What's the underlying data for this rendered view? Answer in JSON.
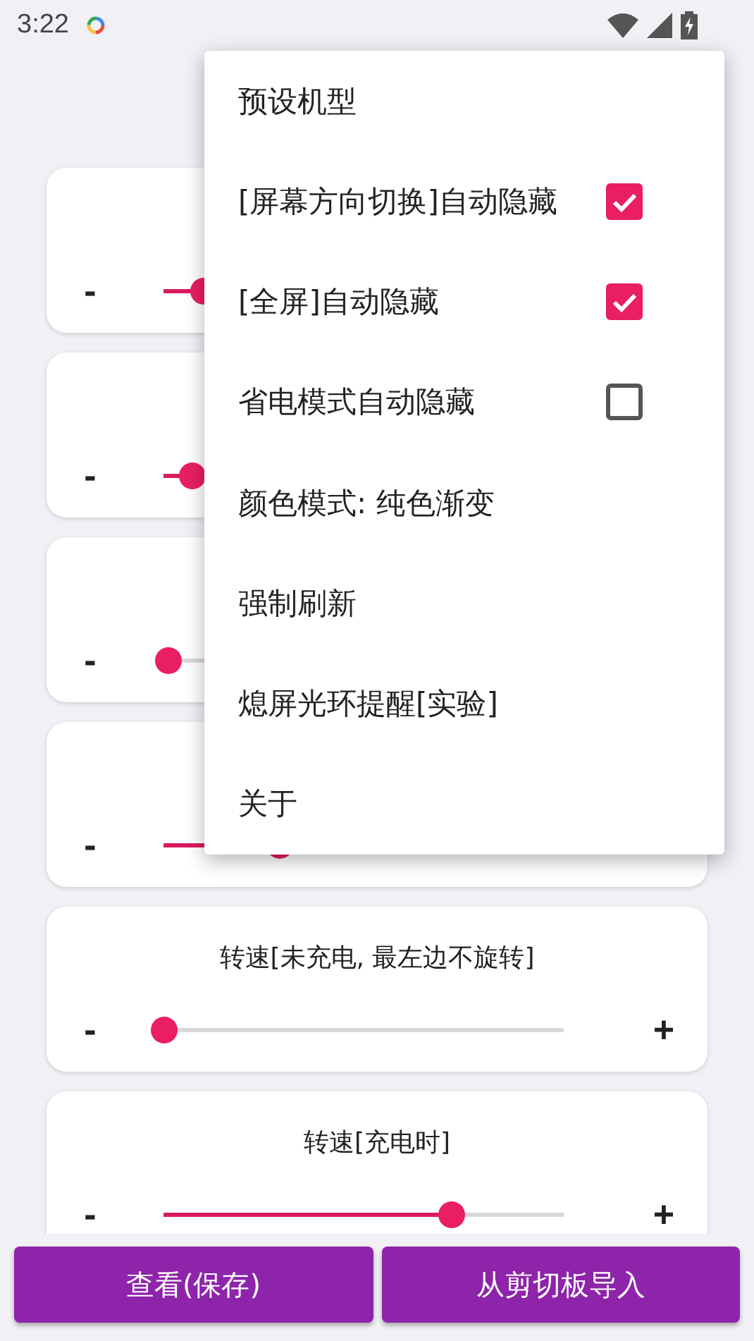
{
  "status_bar": {
    "time": "3:22"
  },
  "cards": [
    {
      "minus": "-",
      "level": 0.1
    },
    {
      "minus": "-",
      "level": 0.07
    },
    {
      "minus": "-",
      "level": 0.01
    },
    {
      "minus": "-",
      "level": 0.29
    },
    {
      "title": "转速[未充电, 最左边不旋转]",
      "minus": "-",
      "plus": "+",
      "level": 0.0
    },
    {
      "title": "转速[充电时]",
      "minus": "-",
      "plus": "+",
      "level": 0.72
    }
  ],
  "menu": [
    {
      "kind": "plain",
      "label": "预设机型"
    },
    {
      "kind": "check",
      "label": "[屏幕方向切换]自动隐藏",
      "checked": true
    },
    {
      "kind": "check",
      "label": "[全屏]自动隐藏",
      "checked": true
    },
    {
      "kind": "check",
      "label": "省电模式自动隐藏",
      "checked": false
    },
    {
      "kind": "plain",
      "label": "颜色模式: 纯色渐变"
    },
    {
      "kind": "plain",
      "label": "强制刷新"
    },
    {
      "kind": "plain",
      "label": "熄屏光环提醒[实验]"
    },
    {
      "kind": "plain",
      "label": "关于"
    }
  ],
  "buttons": [
    "查看(保存)",
    "从剪切板导入"
  ]
}
